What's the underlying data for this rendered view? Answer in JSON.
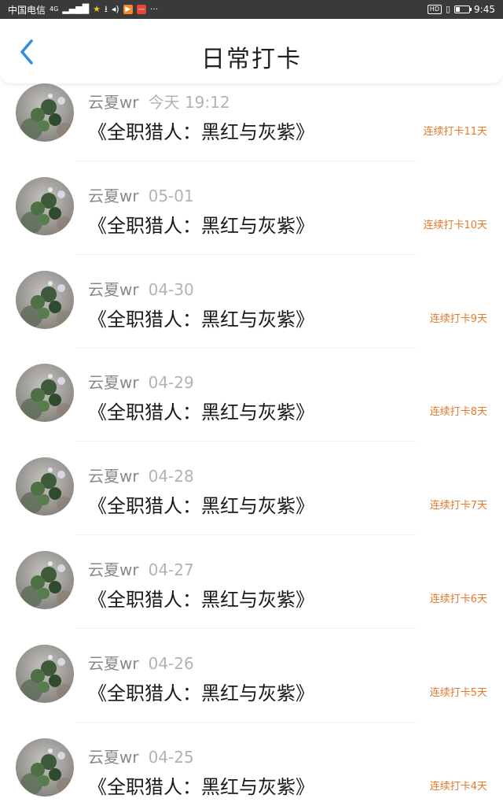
{
  "status_bar": {
    "carrier": "中国电信",
    "network": "4G",
    "time": "9:45",
    "hd": "HD"
  },
  "header": {
    "title": "日常打卡"
  },
  "records": [
    {
      "name": "云夏wr",
      "time": "今天 19:12",
      "book": "《全职猎人：黑红与灰紫》",
      "streak": "连续打卡11天"
    },
    {
      "name": "云夏wr",
      "time": "05-01",
      "book": "《全职猎人：黑红与灰紫》",
      "streak": "连续打卡10天"
    },
    {
      "name": "云夏wr",
      "time": "04-30",
      "book": "《全职猎人：黑红与灰紫》",
      "streak": "连续打卡9天"
    },
    {
      "name": "云夏wr",
      "time": "04-29",
      "book": "《全职猎人：黑红与灰紫》",
      "streak": "连续打卡8天"
    },
    {
      "name": "云夏wr",
      "time": "04-28",
      "book": "《全职猎人：黑红与灰紫》",
      "streak": "连续打卡7天"
    },
    {
      "name": "云夏wr",
      "time": "04-27",
      "book": "《全职猎人：黑红与灰紫》",
      "streak": "连续打卡6天"
    },
    {
      "name": "云夏wr",
      "time": "04-26",
      "book": "《全职猎人：黑红与灰紫》",
      "streak": "连续打卡5天"
    },
    {
      "name": "云夏wr",
      "time": "04-25",
      "book": "《全职猎人：黑红与灰紫》",
      "streak": "连续打卡4天"
    }
  ],
  "colors": {
    "accent_blue": "#2f8fe0",
    "streak_orange": "#e27a2c"
  }
}
